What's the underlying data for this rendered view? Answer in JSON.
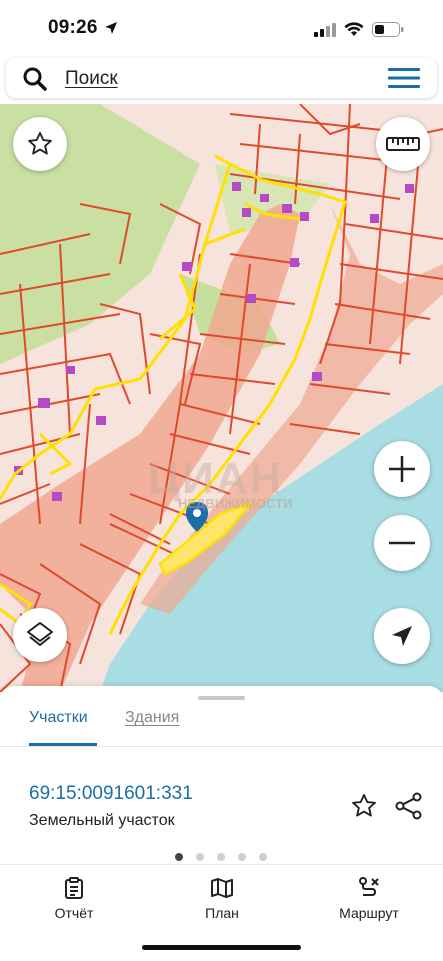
{
  "status_bar": {
    "time": "09:26"
  },
  "search": {
    "placeholder": "Поиск"
  },
  "map": {
    "watermark": "ЦИАН",
    "watermark_sub": "НЕДВИЖИМОСТИ",
    "colors": {
      "plot_border": "#e04a2c",
      "selected": "#ffe100",
      "water": "#a8dde3",
      "green": "#c9e0a2",
      "road": "#f0a891"
    }
  },
  "bottom_sheet": {
    "tabs": [
      {
        "label": "Участки",
        "active": true
      },
      {
        "label": "Здания",
        "active": false
      }
    ],
    "cadastral_number": "69:15:0091601:331",
    "property_type": "Земельный участок",
    "page_dots": {
      "count": 5,
      "active_index": 0
    }
  },
  "nav": {
    "items": [
      {
        "label": "Отчёт",
        "icon": "report-icon"
      },
      {
        "label": "План",
        "icon": "map-icon"
      },
      {
        "label": "Маршрут",
        "icon": "route-icon"
      }
    ]
  },
  "accent_color": "#1a6fa8"
}
